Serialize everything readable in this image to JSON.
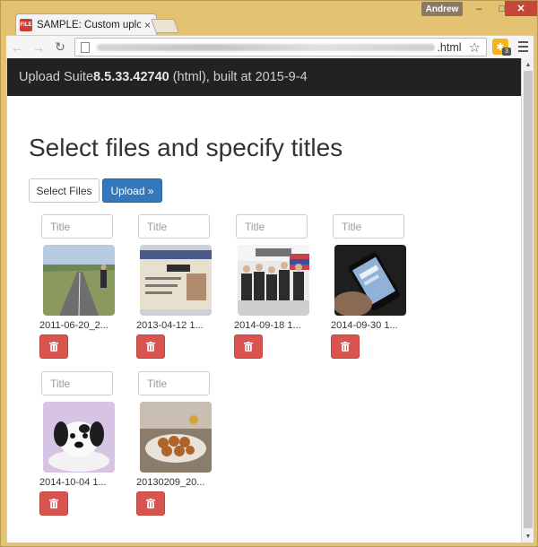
{
  "browser": {
    "tab_title": "SAMPLE: Custom upload l",
    "tab_favicon_text": "FILE",
    "user_name": "Andrew",
    "url_suffix": ".html",
    "extension_badge": "3",
    "accent_close": "#c7463b"
  },
  "navbar": {
    "prefix": "Upload Suite ",
    "version": "8.5.33.42740",
    "suffix": " (html), built at 2015-9-4"
  },
  "page": {
    "title": "Select files and specify titles",
    "select_files_label": "Select Files",
    "upload_label": "Upload »",
    "title_placeholder": "Title"
  },
  "files": [
    {
      "name": "2011-06-20_2...",
      "thumb": "road"
    },
    {
      "name": "2013-04-12 1...",
      "thumb": "card"
    },
    {
      "name": "2014-09-18 1...",
      "thumb": "group"
    },
    {
      "name": "2014-09-30 1...",
      "thumb": "phone"
    },
    {
      "name": "2014-10-04 1...",
      "thumb": "dog"
    },
    {
      "name": "20130209_20...",
      "thumb": "food"
    }
  ],
  "colors": {
    "navbar_bg": "#222222",
    "primary": "#3577bb",
    "danger": "#d9534f"
  },
  "icons": {
    "delete": "trash-icon"
  }
}
